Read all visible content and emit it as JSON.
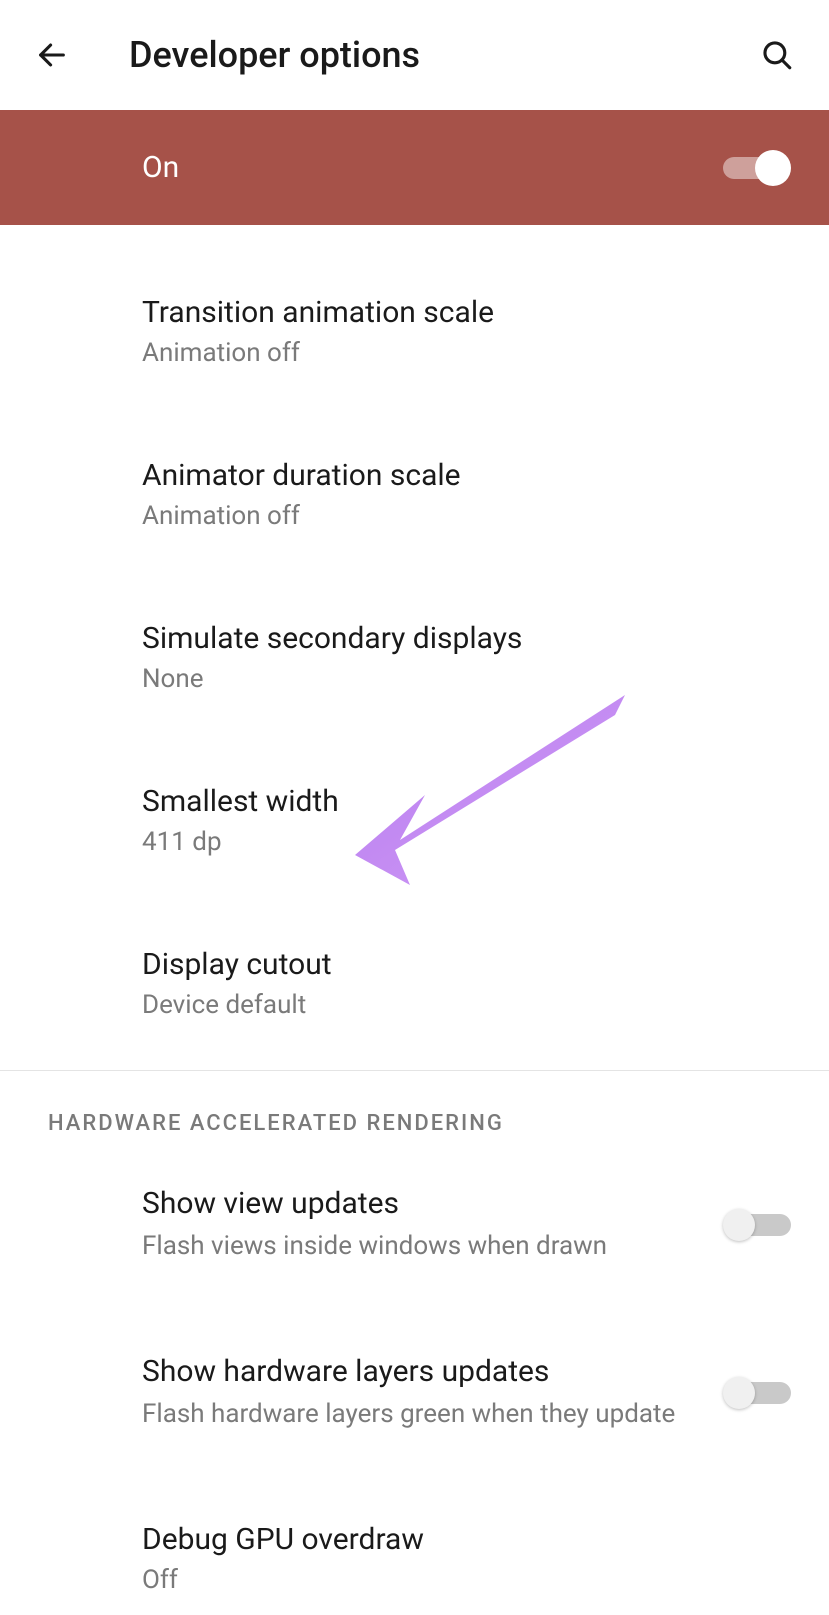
{
  "header": {
    "title": "Developer options"
  },
  "masterToggle": {
    "label": "On",
    "state": true
  },
  "settings": [
    {
      "title": "Transition animation scale",
      "value": "Animation off"
    },
    {
      "title": "Animator duration scale",
      "value": "Animation off"
    },
    {
      "title": "Simulate secondary displays",
      "value": "None"
    },
    {
      "title": "Smallest width",
      "value": "411 dp"
    },
    {
      "title": "Display cutout",
      "value": "Device default"
    }
  ],
  "section": {
    "header": "HARDWARE ACCELERATED RENDERING"
  },
  "toggleSettings": [
    {
      "title": "Show view updates",
      "desc": "Flash views inside windows when drawn",
      "state": false
    },
    {
      "title": "Show hardware layers updates",
      "desc": "Flash hardware layers green when they update",
      "state": false
    }
  ],
  "lastSetting": {
    "title": "Debug GPU overdraw",
    "value": "Off"
  }
}
